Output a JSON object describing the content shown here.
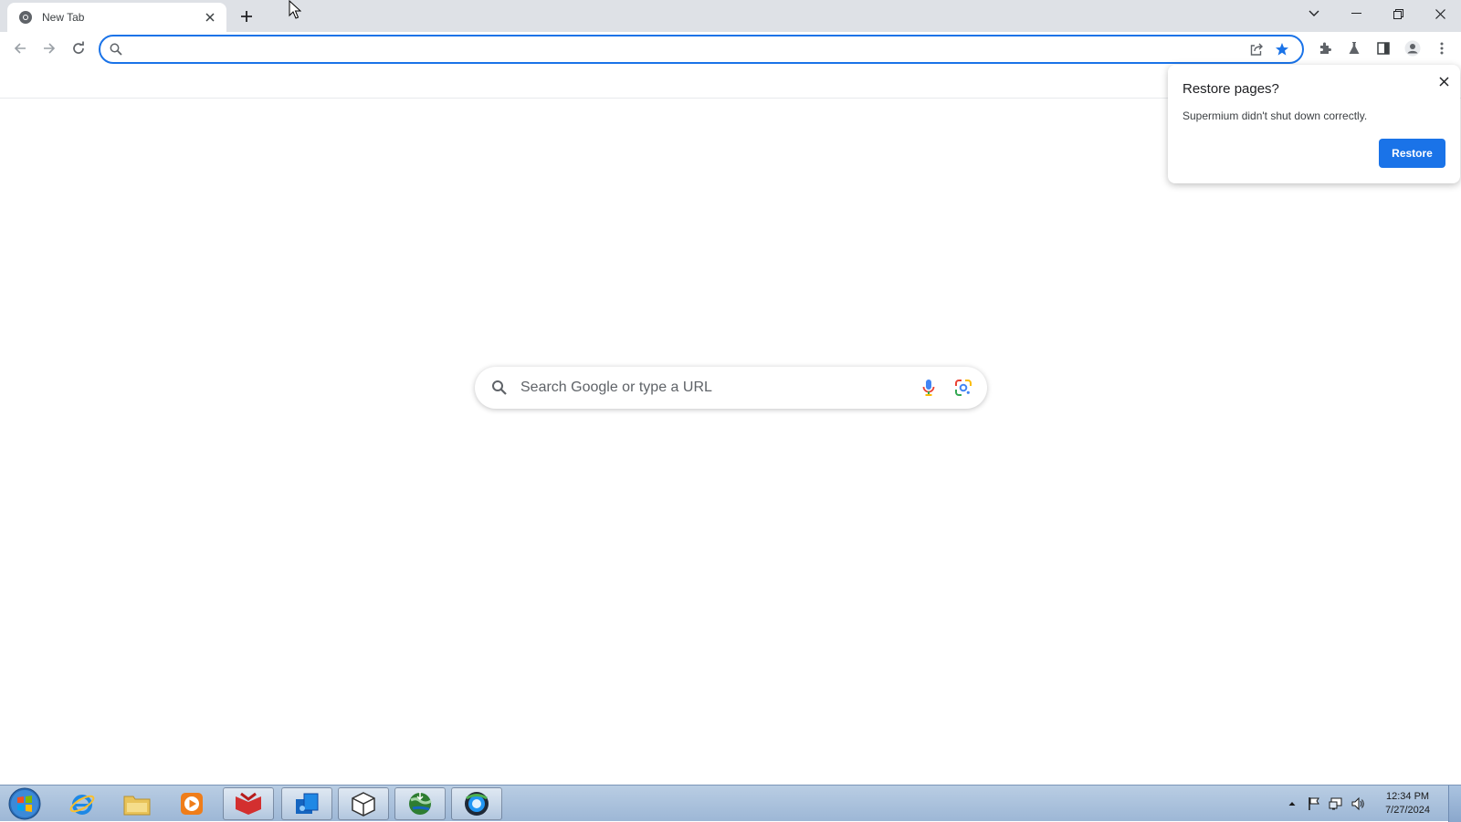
{
  "tabs": [
    {
      "title": "New Tab",
      "icon": "chrome-icon",
      "active": true
    }
  ],
  "omnibox": {
    "value": "",
    "placeholder": ""
  },
  "ntp": {
    "search_placeholder": "Search Google or type a URL"
  },
  "restore_bubble": {
    "title": "Restore pages?",
    "message": "Supermium didn't shut down correctly.",
    "button_label": "Restore"
  },
  "taskbar": {
    "apps": [
      {
        "name": "internet-explorer",
        "open": false
      },
      {
        "name": "file-explorer",
        "open": false
      },
      {
        "name": "media-player",
        "open": false
      },
      {
        "name": "red-app",
        "open": true
      },
      {
        "name": "blue-app",
        "open": true
      },
      {
        "name": "box-app",
        "open": true
      },
      {
        "name": "globe-download-app",
        "open": true
      },
      {
        "name": "supermium-browser",
        "open": true
      }
    ],
    "clock_time": "12:34 PM",
    "clock_date": "7/27/2024"
  },
  "colors": {
    "accent": "#1a73e8",
    "tabstrip": "#dee1e6",
    "taskbar": "#a9c1de"
  }
}
